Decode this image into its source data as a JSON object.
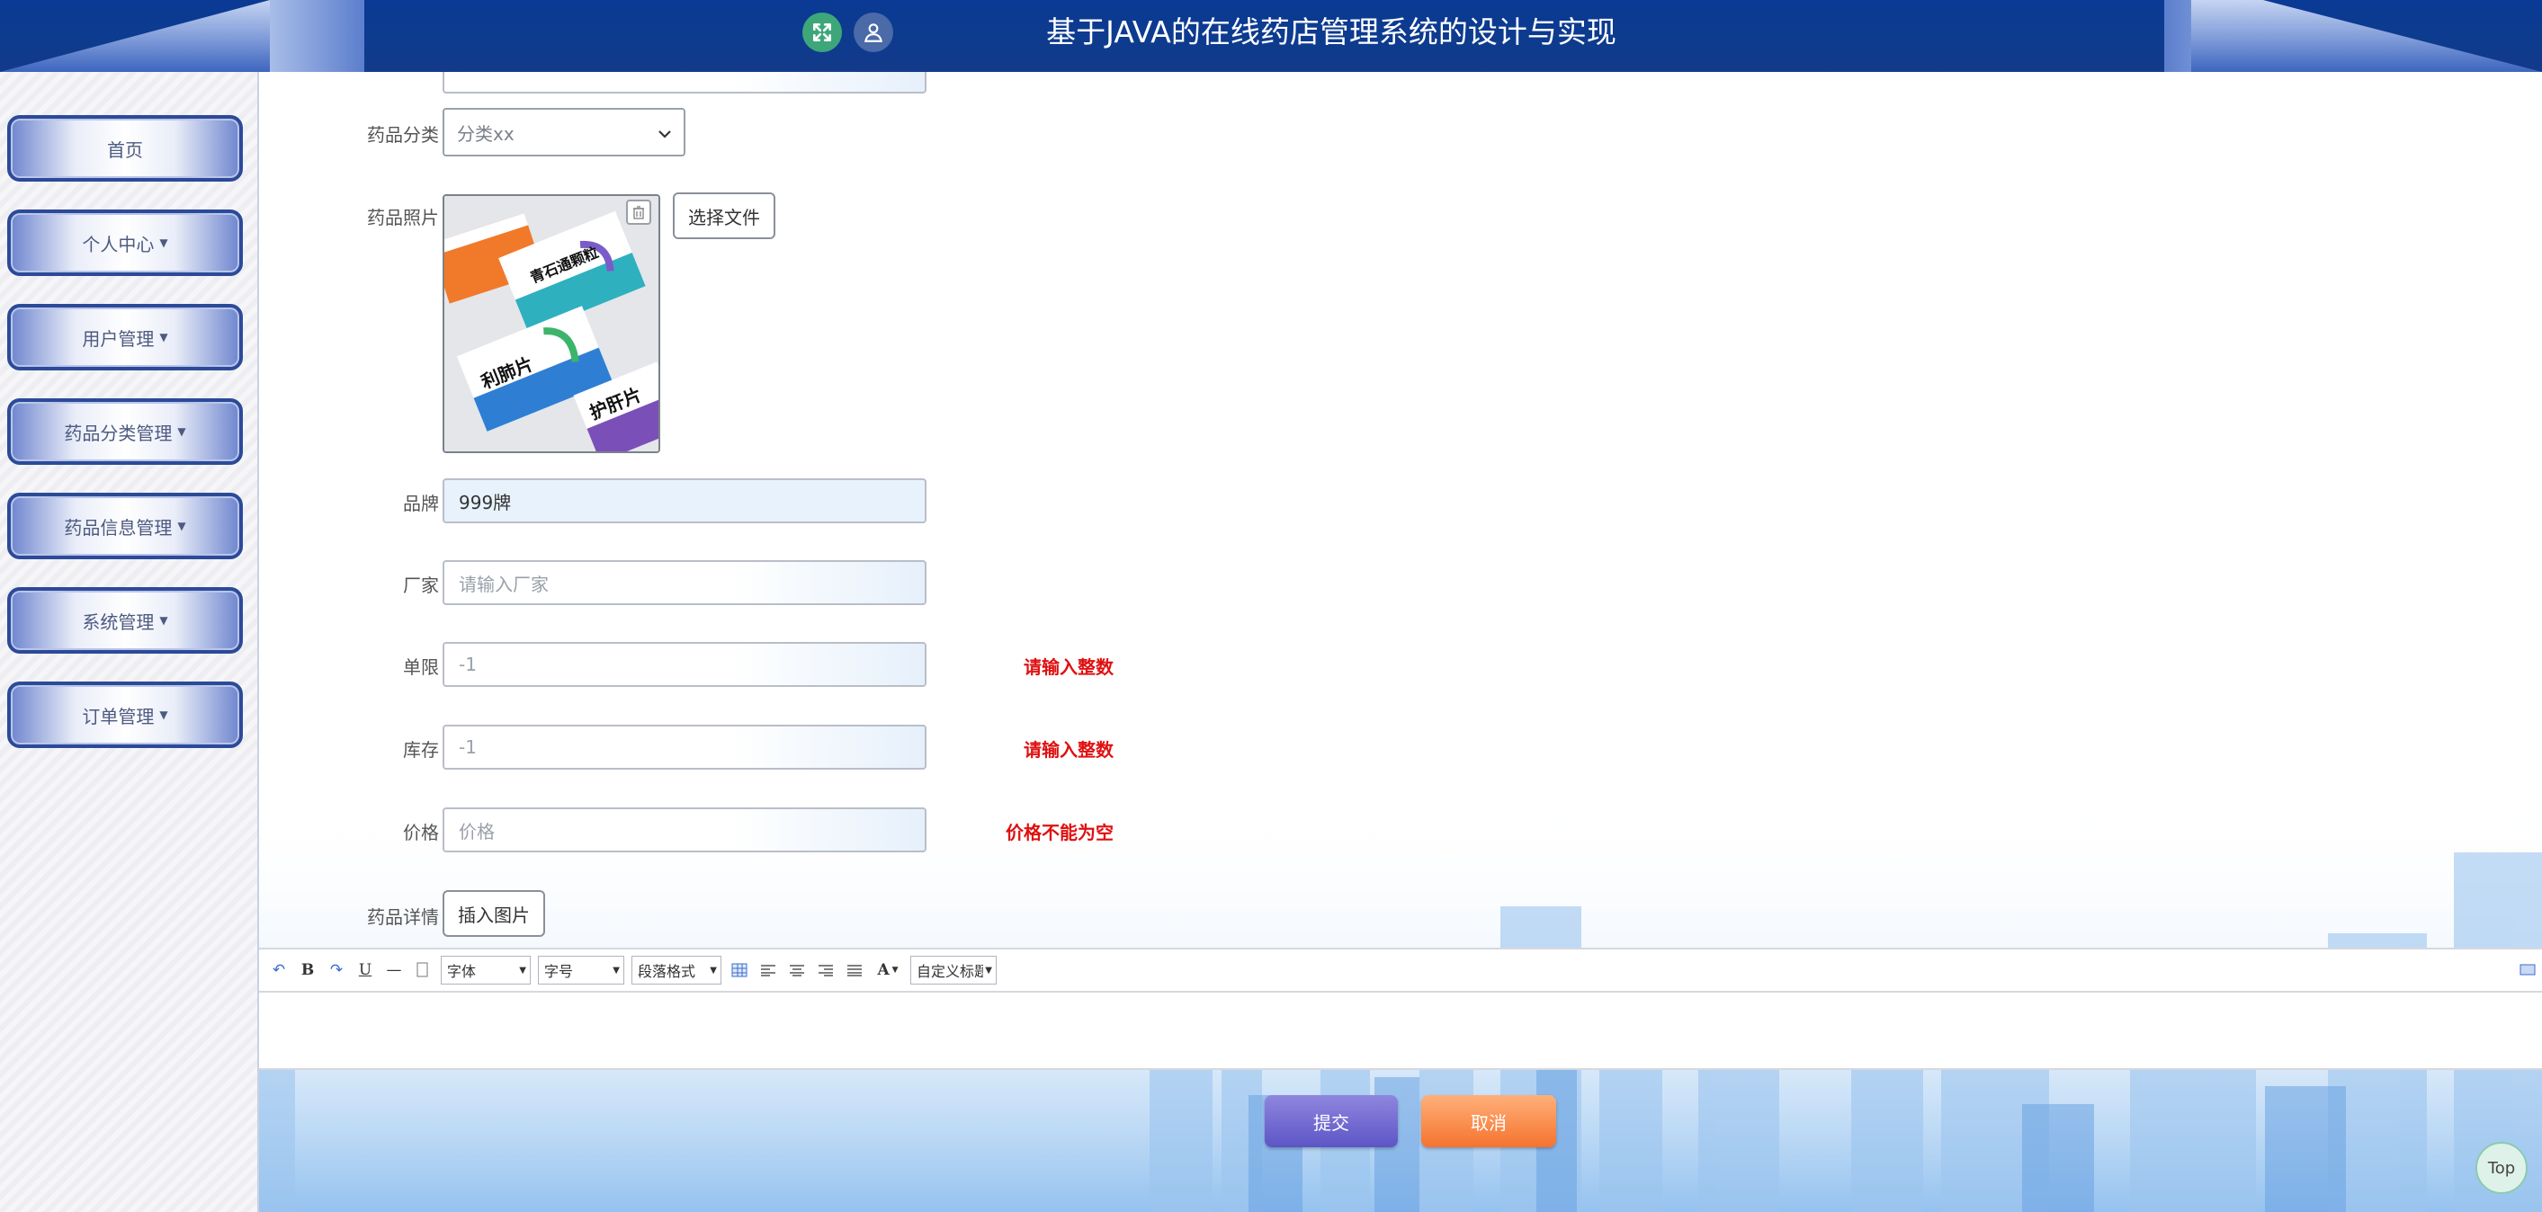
{
  "header": {
    "title": "基于JAVA的在线药店管理系统的设计与实现",
    "icons": [
      "fullscreen-icon",
      "user-icon"
    ]
  },
  "sidebar": {
    "items": [
      {
        "label": "首页",
        "has_dropdown": false
      },
      {
        "label": "个人中心",
        "has_dropdown": true
      },
      {
        "label": "用户管理",
        "has_dropdown": true
      },
      {
        "label": "药品分类管理",
        "has_dropdown": true
      },
      {
        "label": "药品信息管理",
        "has_dropdown": true
      },
      {
        "label": "系统管理",
        "has_dropdown": true
      },
      {
        "label": "订单管理",
        "has_dropdown": true
      }
    ]
  },
  "form": {
    "category": {
      "label": "药品分类",
      "selected": "分类xx"
    },
    "photo": {
      "label": "药品照片",
      "choose_file": "选择文件",
      "image_text": [
        "青石通颗粒",
        "利肺片",
        "护肝片"
      ]
    },
    "brand": {
      "label": "品牌",
      "value": "999牌"
    },
    "manufacturer": {
      "label": "厂家",
      "placeholder": "请输入厂家"
    },
    "single_limit": {
      "label": "单限",
      "value": "-1",
      "error": "请输入整数"
    },
    "stock": {
      "label": "库存",
      "value": "-1",
      "error": "请输入整数"
    },
    "price": {
      "label": "价格",
      "placeholder": "价格",
      "error": "价格不能为空"
    },
    "details": {
      "label": "药品详情",
      "insert_image": "插入图片"
    }
  },
  "editor": {
    "toolbar": {
      "font_family": "字体",
      "font_size": "字号",
      "paragraph": "段落格式",
      "font_color": "A",
      "custom_title": "自定义标题",
      "icons": [
        "undo-icon",
        "bold-icon",
        "redo-icon",
        "underline-icon",
        "horizontal-rule-icon",
        "clear-format-icon",
        "table-icon",
        "align-left-icon",
        "align-center-icon",
        "align-right-icon",
        "justify-icon",
        "font-color-icon",
        "fullscreen-editor-icon"
      ]
    }
  },
  "actions": {
    "submit": "提交",
    "cancel": "取消",
    "top": "Top"
  },
  "colors": {
    "header": "#0d3b8e",
    "error": "#e01010",
    "submit": "#5d55c6",
    "cancel": "#f5732e"
  }
}
